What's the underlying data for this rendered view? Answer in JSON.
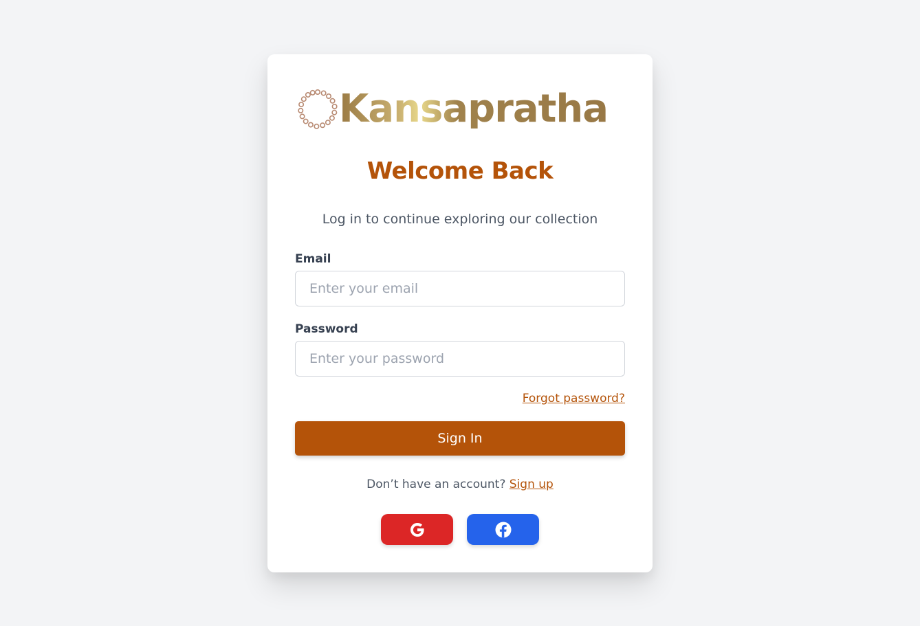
{
  "brand": {
    "logo_text": "Kansapratha"
  },
  "header": {
    "title": "Welcome Back",
    "subtitle": "Log in to continue exploring our collection"
  },
  "form": {
    "email_label": "Email",
    "email_placeholder": "Enter your email",
    "email_value": "",
    "password_label": "Password",
    "password_placeholder": "Enter your password",
    "password_value": "",
    "forgot_label": "Forgot password?",
    "submit_label": "Sign In"
  },
  "footer": {
    "signup_prompt": "Don’t have an account?",
    "signup_link": "Sign up"
  },
  "social": {
    "google_icon": "google-icon",
    "facebook_icon": "facebook-icon"
  },
  "colors": {
    "background": "#f3f4f6",
    "accent": "#b45309",
    "google": "#dc2626",
    "facebook": "#2563eb"
  }
}
